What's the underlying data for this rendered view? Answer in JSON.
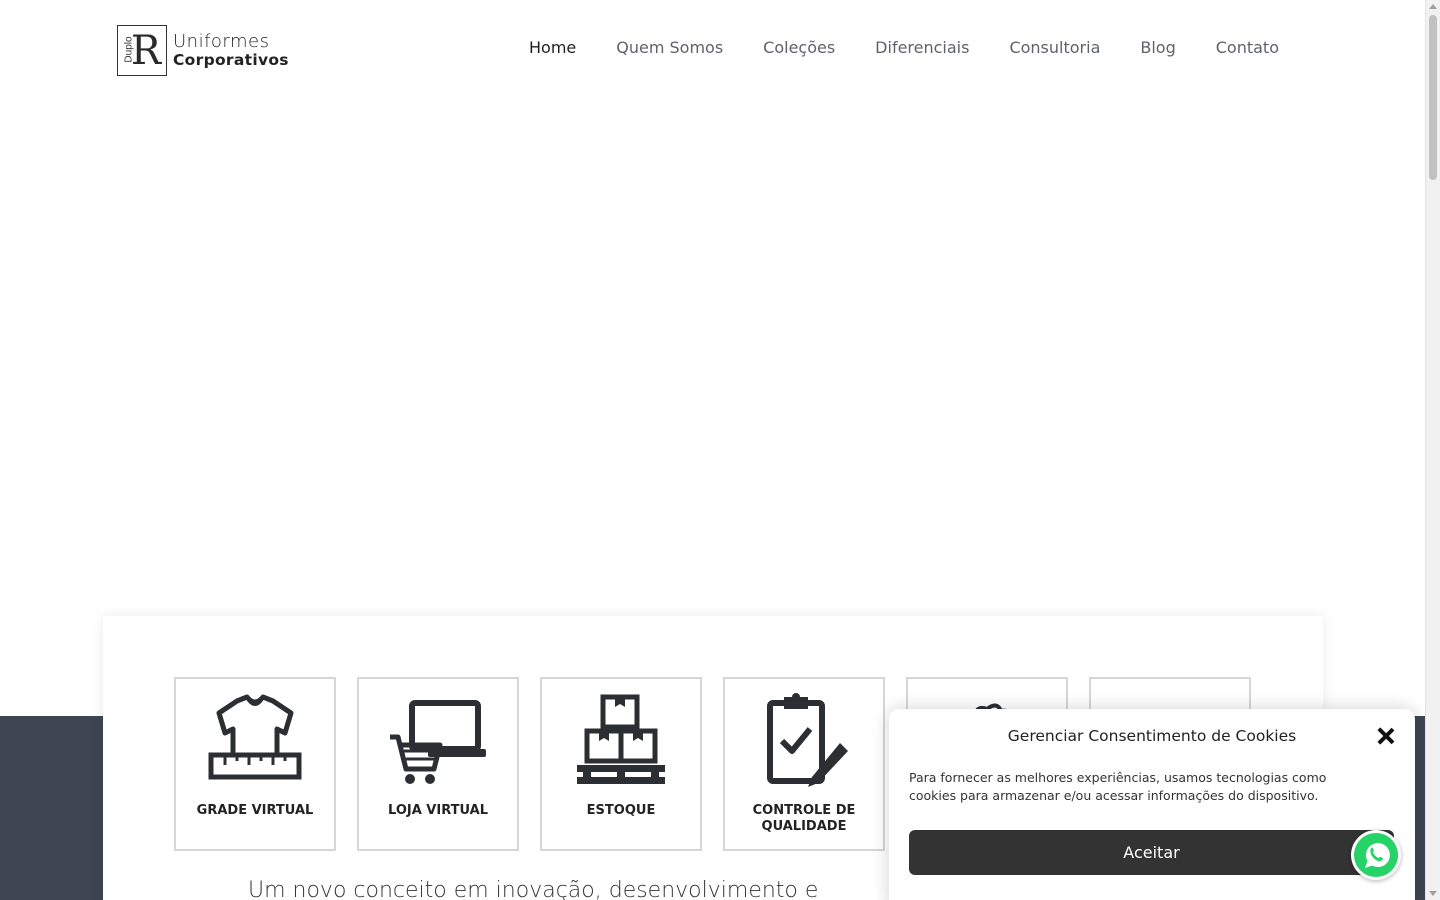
{
  "logo": {
    "mark_letter": "R",
    "mark_vertical": "Duplo",
    "line1": "Uniformes",
    "line2": "Corporativos"
  },
  "nav": {
    "items": [
      {
        "label": "Home",
        "active": true
      },
      {
        "label": "Quem Somos"
      },
      {
        "label": "Coleções"
      },
      {
        "label": "Diferenciais"
      },
      {
        "label": "Consultoria"
      },
      {
        "label": "Blog"
      },
      {
        "label": "Contato"
      }
    ]
  },
  "features": [
    {
      "label": "GRADE VIRTUAL",
      "icon": "shirt-ruler-icon"
    },
    {
      "label": "LOJA VIRTUAL",
      "icon": "cart-laptop-icon"
    },
    {
      "label": "ESTOQUE",
      "icon": "boxes-pallet-icon"
    },
    {
      "label": "CONTROLE DE QUALIDADE",
      "icon": "clipboard-check-icon"
    },
    {
      "label": "",
      "icon": "badge-icon"
    },
    {
      "label": "",
      "icon": "support-icon"
    }
  ],
  "tagline": "Um novo conceito em inovação, desenvolvimento e",
  "cookie": {
    "title": "Gerenciar Consentimento de Cookies",
    "text": "Para fornecer as melhores experiências, usamos tecnologias como cookies para armazenar e/ou acessar informações do dispositivo.",
    "accept_label": "Aceitar"
  },
  "colors": {
    "dark_band": "#3d4652",
    "button": "#333333",
    "whatsapp": "#25d366"
  }
}
